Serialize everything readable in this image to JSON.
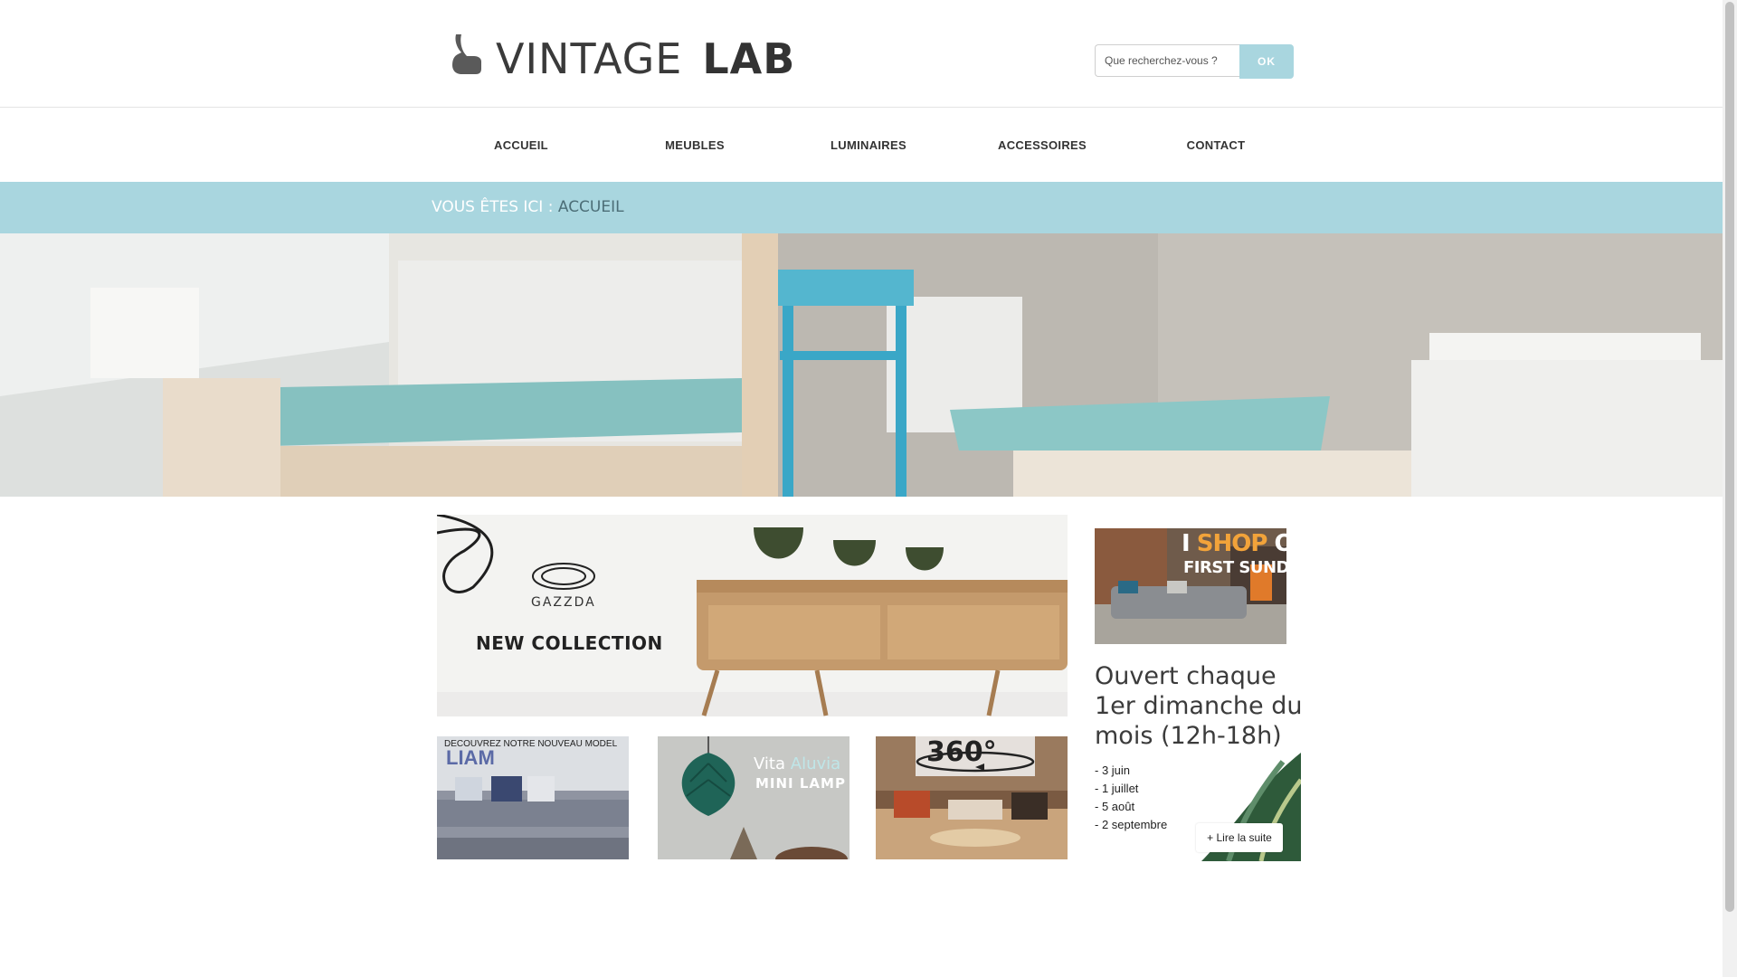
{
  "brand": {
    "name_part1": "VINTAGE",
    "name_part2": "LAB"
  },
  "search": {
    "placeholder": "Que recherchez-vous ?",
    "button_label": "OK"
  },
  "nav": {
    "items": [
      {
        "label": "ACCUEIL"
      },
      {
        "label": "MEUBLES"
      },
      {
        "label": "LUMINAIRES"
      },
      {
        "label": "ACCESSOIRES"
      },
      {
        "label": "CONTACT"
      }
    ]
  },
  "breadcrumb": {
    "prefix": "VOUS ÊTES ICI :",
    "current": "ACCUEIL"
  },
  "main_banner": {
    "brand": "GAZZDA",
    "title": "NEW COLLECTION"
  },
  "tiles": [
    {
      "subtitle": "DECOUVREZ NOTRE NOUVEAU MODEL",
      "title": "LIAM"
    },
    {
      "title_part1": "Vita",
      "title_part2": "Aluvia",
      "subtitle": "MINI LAMP"
    },
    {
      "title": "360°"
    }
  ],
  "sidebar": {
    "promo_line1_a": "I ",
    "promo_line1_b": "SHOP",
    "promo_line1_c": " ON",
    "promo_line2": "FIRST SUNDAYS",
    "title": "Ouvert chaque 1er dimanche du mois (12h-18h)",
    "dates": [
      "- 3 juin",
      "- 1 juillet",
      "- 5 août",
      "- 2 septembre"
    ],
    "more_label": "+ Lire la suite"
  },
  "colors": {
    "accent": "#a9d6df",
    "breadcrumb_current": "#4c6e77",
    "promo_orange": "#f2a33a"
  }
}
